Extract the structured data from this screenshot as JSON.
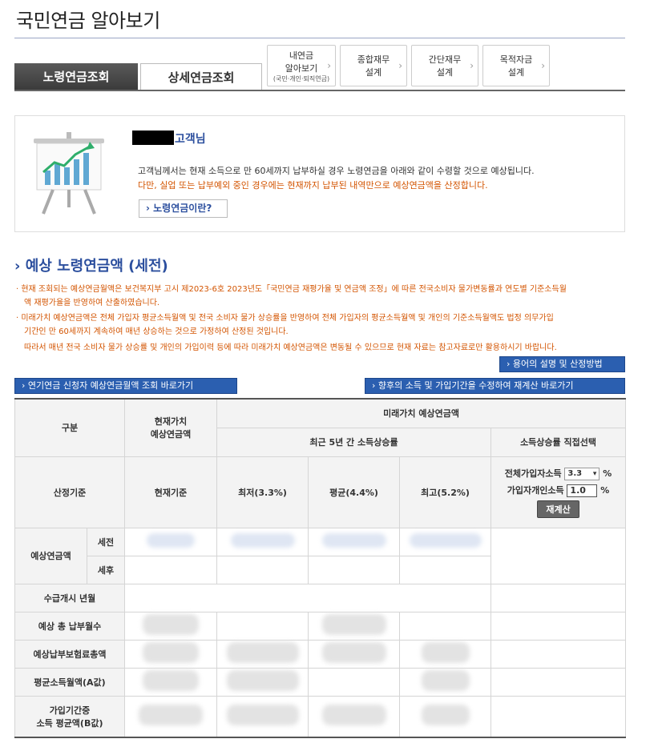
{
  "header": {
    "title": "국민연금 알아보기"
  },
  "tabs": {
    "basic": "노령연금조회",
    "detail": "상세연금조회",
    "mine": {
      "line1": "내연금",
      "line2": "알아보기",
      "sub": "(국민·개인·퇴직연금)"
    },
    "total": {
      "line1": "종합재무",
      "line2": "설계"
    },
    "simple": {
      "line1": "간단재무",
      "line2": "설계"
    },
    "goal": {
      "line1": "목적자금",
      "line2": "설계"
    }
  },
  "info": {
    "customer_suffix": "고객님",
    "desc1": "고객님께서는 현재 소득으로 만 60세까지 납부하실 경우 노령연금을 아래와 같이 수령할 것으로 예상됩니다.",
    "desc2": "다만, 실업 또는 납부예외 중인 경우에는 현재까지 납부된 내역만으로 예상연금액을 산정합니다.",
    "what_button": "› 노령연금이란?"
  },
  "section": {
    "title": "예상 노령연금액 (세전)",
    "note1a": "· 현재 조회되는 예상연금월액은 보건복지부 고시 제2023-6호 2023년도「국민연금 재평가율 및 연금액 조정」에 따른 전국소비자 물가변동률과 연도별 기준소득월",
    "note1b": "액 재평가율을 반영하여 산출하였습니다.",
    "note2a": "· 미래가치 예상연금액은 전체 가입자 평균소득월액 및 전국 소비자 물가 상승률을 반영하여 전체 가입자의 평균소득월액 및 개인의 기준소득월액도 법정 의무가입",
    "note2b": "기간인 만 60세까지 계속하여 매년 상승하는 것으로 가정하여 산정된 것입니다.",
    "note3": "따라서 매년 전국 소비자 물가 상승률 및 개인의 가입이력 등에 따라 미래가치 예상연금액은 변동될 수 있으므로 현재 자료는 참고자료로만 활용하시기 바랍니다."
  },
  "buttons": {
    "terms": "› 용어의 설명 및 산정방법",
    "pension": "› 연기연금 신청자 예상연금월액 조회 바로가기",
    "recalc": "› 향후의 소득 및 가입기간을 수정하여 재계산 바로가기"
  },
  "table": {
    "h_category": "구분",
    "h_present_1": "현재가치",
    "h_present_2": "예상연금액",
    "h_future": "미래가치 예상연금액",
    "h_recent": "최근 5년 간 소득상승률",
    "h_direct": "소득상승률 직접선택",
    "r_basis": "산정기준",
    "c_current": "현재기준",
    "c_low": "최저(3.3%)",
    "c_avg": "평균(4.4%)",
    "c_high": "최고(5.2%)",
    "total_label": "전체가입자소득",
    "total_value": "3.3",
    "personal_label": "가입자개인소득",
    "personal_value": "1.0",
    "pct": "%",
    "recalc_btn": "재계산",
    "r_expected": "예상연금액",
    "r_pre": "세전",
    "r_post": "세후",
    "r_start": "수급개시 년월",
    "r_months": "예상 총 납부월수",
    "r_premium": "예상납부보험료총액",
    "r_avg_a": "평균소득월액(A값)",
    "r_avg_b1": "가입기간중",
    "r_avg_b2": "소득 평균액(B값)"
  }
}
